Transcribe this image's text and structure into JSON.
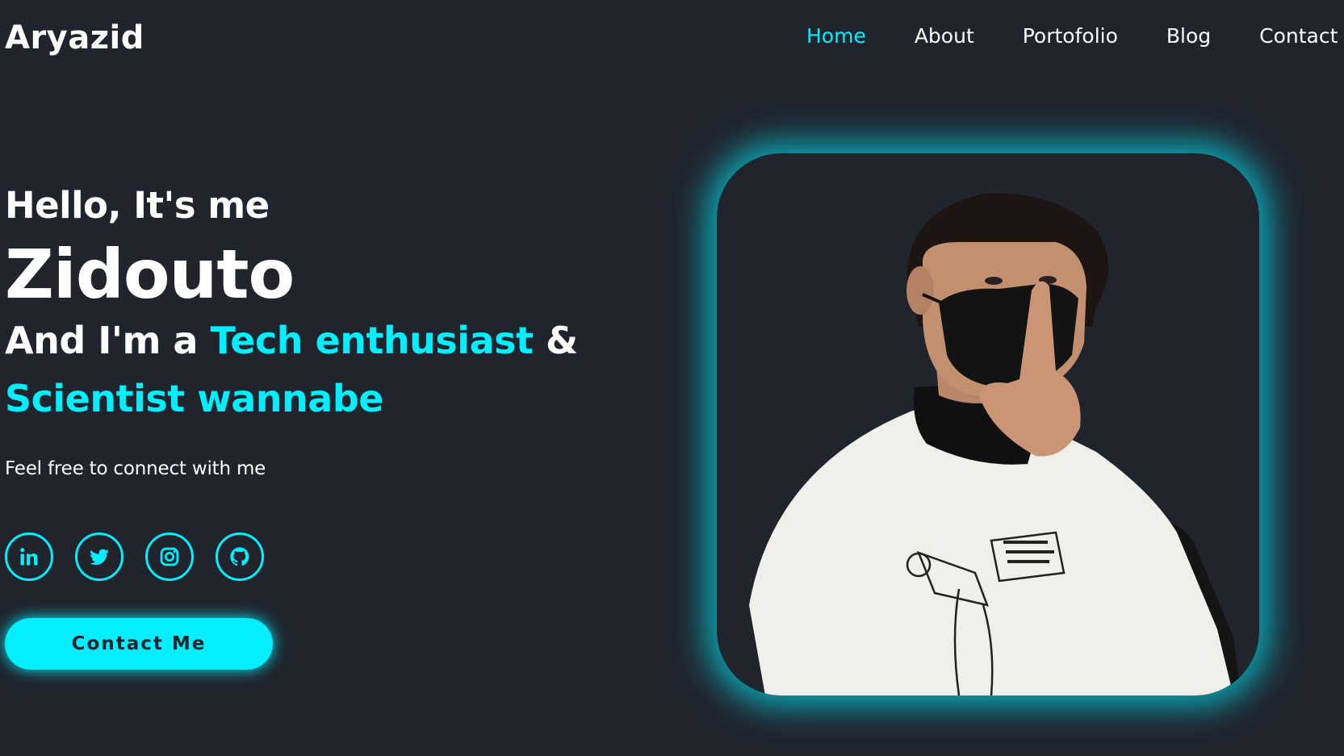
{
  "header": {
    "logo": "Aryazid",
    "nav": [
      {
        "label": "Home",
        "active": true
      },
      {
        "label": "About",
        "active": false
      },
      {
        "label": "Portofolio",
        "active": false
      },
      {
        "label": "Blog",
        "active": false
      },
      {
        "label": "Contact",
        "active": false
      }
    ]
  },
  "hero": {
    "greeting": "Hello, It's me",
    "name": "Zidouto",
    "tagline_prefix": "And I'm a ",
    "tagline_accent_1": "Tech enthusiast",
    "tagline_amp": " &",
    "tagline_accent_2": "Scientist wannabe",
    "description": "Feel free to connect with me"
  },
  "socials": [
    {
      "icon": "linkedin-icon"
    },
    {
      "icon": "twitter-icon"
    },
    {
      "icon": "instagram-icon"
    },
    {
      "icon": "github-icon"
    }
  ],
  "cta": {
    "label": "Contact Me"
  },
  "colors": {
    "background": "#1f242d",
    "accent": "#00eeff",
    "text": "#ffffff"
  }
}
